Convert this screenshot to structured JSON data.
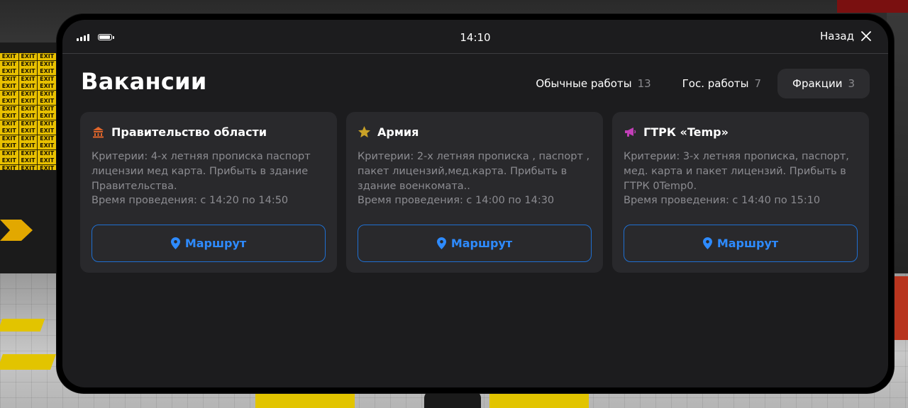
{
  "status": {
    "time": "14:10",
    "back_label": "Назад"
  },
  "page": {
    "title": "Вакансии"
  },
  "tabs": [
    {
      "label": "Обычные работы",
      "count": "13",
      "active": false
    },
    {
      "label": "Гос. работы",
      "count": "7",
      "active": false
    },
    {
      "label": "Фракции",
      "count": "3",
      "active": true
    }
  ],
  "cards": [
    {
      "icon": "government-building-icon",
      "icon_color": "#e0652a",
      "title": "Правительство области",
      "criteria": "Критерии: 4-х летняя прописка паспорт лицензии мед карта. Прибыть в здание Правительства.",
      "time": "Время проведения: с 14:20 по 14:50",
      "button": "Маршрут"
    },
    {
      "icon": "star-icon",
      "icon_color": "#c9a227",
      "title": "Армия",
      "criteria": "Критерии: 2-х летняя прописка , паспорт , пакет лицензий,мед.карта. Прибыть в здание военкомата..",
      "time": "Время проведения: с 14:00 по 14:30",
      "button": "Маршрут"
    },
    {
      "icon": "megaphone-icon",
      "icon_color": "#c23fb8",
      "title": "ГТРК «Temp»",
      "criteria": "Критерии: 3-х летняя прописка, паспорт, мед. карта и пакет лицензий. Прибыть в ГТРК 0Temp0.",
      "time": "Время проведения: с 14:40 по 15:10",
      "button": "Маршрут"
    }
  ],
  "colors": {
    "accent": "#2e8bff",
    "panel": "#1c1c1e",
    "card": "#29292c"
  },
  "backdrop": {
    "sign_text": "EXIT"
  }
}
